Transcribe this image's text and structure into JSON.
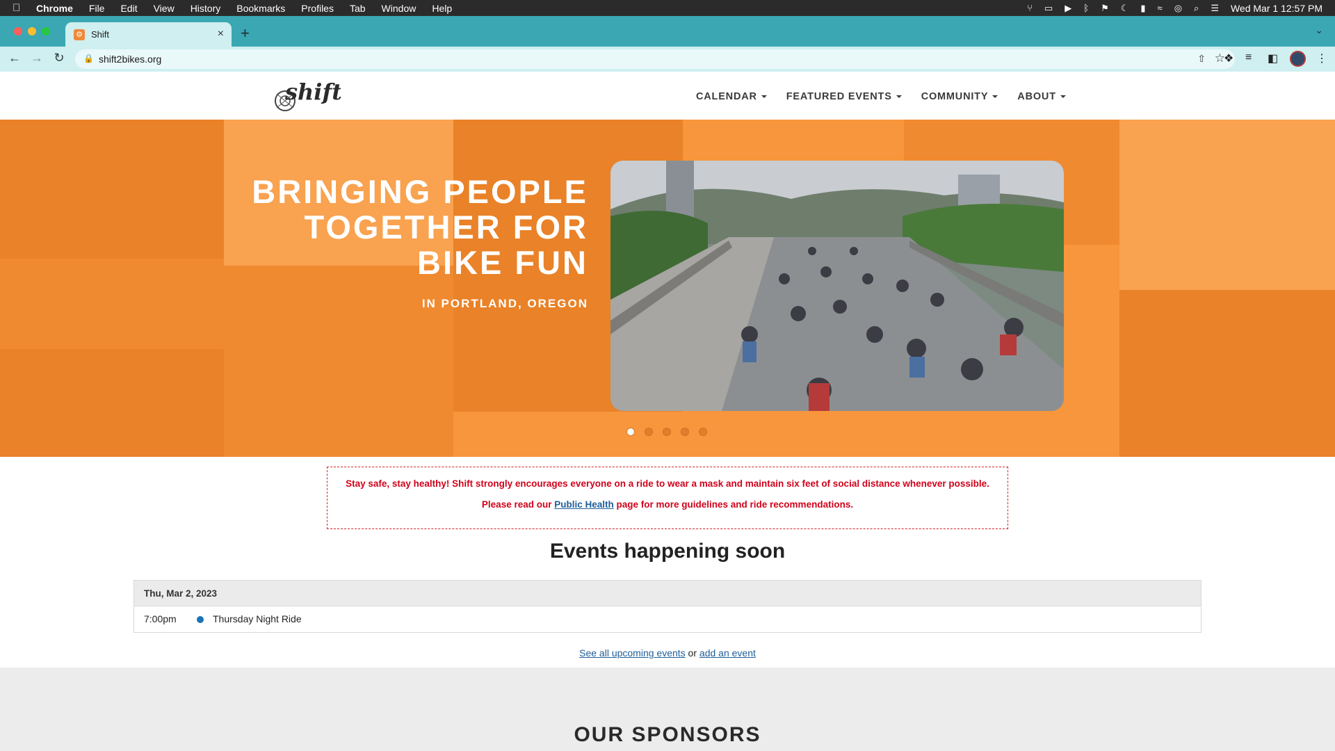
{
  "menubar": {
    "app": "Chrome",
    "items": [
      "File",
      "Edit",
      "View",
      "History",
      "Bookmarks",
      "Profiles",
      "Tab",
      "Window",
      "Help"
    ],
    "clock": "Wed Mar 1  12:57 PM"
  },
  "browser": {
    "tab_title": "Shift",
    "url": "shift2bikes.org"
  },
  "site": {
    "logo_text": "shift",
    "nav": [
      "CALENDAR",
      "FEATURED EVENTS",
      "COMMUNITY",
      "ABOUT"
    ]
  },
  "hero": {
    "title_lines": [
      "BRINGING PEOPLE",
      "TOGETHER FOR",
      "BIKE FUN"
    ],
    "subtitle": "IN PORTLAND, OREGON",
    "slide_count": 5,
    "active_slide": 1
  },
  "notice": {
    "line1": "Stay safe, stay healthy! Shift strongly encourages everyone on a ride to wear a mask and maintain six feet of social distance whenever possible.",
    "line2_before": "Please read our ",
    "line2_link": "Public Health",
    "line2_after": " page for more guidelines and ride recommendations."
  },
  "events": {
    "heading": "Events happening soon",
    "date": "Thu, Mar 2, 2023",
    "items": [
      {
        "time": "7:00pm",
        "name": "Thursday Night Ride"
      }
    ],
    "see_all": "See all upcoming events",
    "or_text": " or ",
    "add_event": "add an event"
  },
  "sponsors": {
    "heading": "OUR SPONSORS"
  },
  "colors": {
    "hero_orange": "#f7963c",
    "notice_red": "#d0021b",
    "link_blue": "#1f5e9a",
    "tab_teal": "#3ba7b3"
  }
}
